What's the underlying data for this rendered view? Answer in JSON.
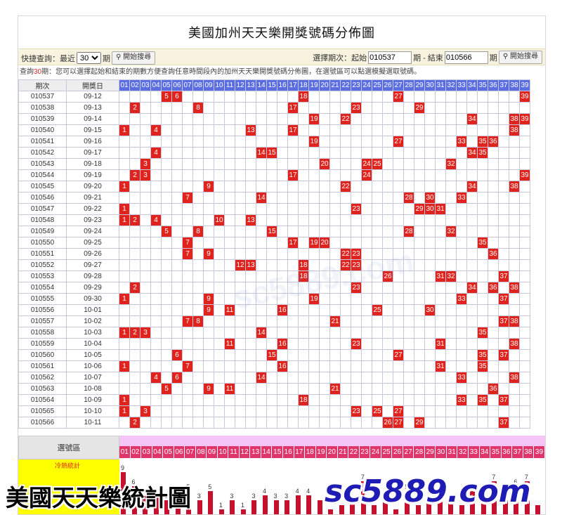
{
  "title": "美國加州天天樂開獎號碼分佈圖",
  "quick_query": {
    "label": "快捷查詢：最近",
    "value": "30",
    "options": [
      "30"
    ],
    "suffix": "期",
    "button": "開始搜尋"
  },
  "range_query": {
    "label": "選擇期次：起始",
    "start": "010537",
    "mid": "期 - 結束",
    "end": "010566",
    "suffix": "期",
    "button": "開始搜尋"
  },
  "note": {
    "prefix": "查詢",
    "count": "30",
    "text": "期：您可以選擇起始和結束的期數方便查詢任意時間段內的加州天天樂開獎號碼分佈圖，在選號區可以點選模擬選取號碼。"
  },
  "headers": {
    "period": "期次",
    "date": "開獎日"
  },
  "numbers": [
    "01",
    "02",
    "03",
    "04",
    "05",
    "06",
    "07",
    "08",
    "09",
    "10",
    "11",
    "12",
    "13",
    "14",
    "15",
    "16",
    "17",
    "18",
    "19",
    "20",
    "21",
    "22",
    "23",
    "24",
    "25",
    "26",
    "27",
    "28",
    "29",
    "30",
    "31",
    "32",
    "33",
    "34",
    "35",
    "36",
    "37",
    "38",
    "39"
  ],
  "draws": [
    {
      "period": "010537",
      "date": "09-12",
      "nums": [
        5,
        6,
        18,
        27,
        39
      ]
    },
    {
      "period": "010538",
      "date": "09-13",
      "nums": [
        2,
        8,
        17,
        23,
        29
      ]
    },
    {
      "period": "010539",
      "date": "09-14",
      "nums": [
        19,
        22,
        34,
        38,
        39
      ]
    },
    {
      "period": "010540",
      "date": "09-15",
      "nums": [
        1,
        4,
        13,
        17,
        38
      ]
    },
    {
      "period": "010541",
      "date": "09-16",
      "nums": [
        19,
        27,
        33,
        35,
        36
      ]
    },
    {
      "period": "010542",
      "date": "09-17",
      "nums": [
        4,
        14,
        15,
        34,
        35
      ]
    },
    {
      "period": "010543",
      "date": "09-18",
      "nums": [
        3,
        20,
        24,
        25,
        32
      ]
    },
    {
      "period": "010544",
      "date": "09-19",
      "nums": [
        2,
        3,
        17,
        24,
        39
      ]
    },
    {
      "period": "010545",
      "date": "09-20",
      "nums": [
        1,
        9,
        22,
        34,
        38
      ]
    },
    {
      "period": "010546",
      "date": "09-21",
      "nums": [
        7,
        14,
        28,
        30,
        33
      ]
    },
    {
      "period": "010547",
      "date": "09-22",
      "nums": [
        1,
        23,
        29,
        30,
        31
      ]
    },
    {
      "period": "010548",
      "date": "09-23",
      "nums": [
        1,
        2,
        4,
        10,
        13
      ]
    },
    {
      "period": "010549",
      "date": "09-24",
      "nums": [
        5,
        8,
        15,
        28,
        32
      ]
    },
    {
      "period": "010550",
      "date": "09-25",
      "nums": [
        7,
        17,
        19,
        20,
        35
      ]
    },
    {
      "period": "010551",
      "date": "09-26",
      "nums": [
        7,
        9,
        22,
        23,
        36
      ]
    },
    {
      "period": "010552",
      "date": "09-27",
      "nums": [
        12,
        13,
        18,
        22,
        23
      ]
    },
    {
      "period": "010553",
      "date": "09-28",
      "nums": [
        18,
        26,
        31,
        32,
        37
      ]
    },
    {
      "period": "010554",
      "date": "09-29",
      "nums": [
        2,
        23,
        34,
        36,
        38
      ]
    },
    {
      "period": "010555",
      "date": "09-30",
      "nums": [
        1,
        9,
        19,
        33,
        37
      ]
    },
    {
      "period": "010556",
      "date": "10-01",
      "nums": [
        9,
        11,
        16,
        25,
        30
      ]
    },
    {
      "period": "010557",
      "date": "10-02",
      "nums": [
        7,
        8,
        21,
        37,
        38
      ]
    },
    {
      "period": "010558",
      "date": "10-03",
      "nums": [
        1,
        2,
        3,
        14,
        35
      ]
    },
    {
      "period": "010559",
      "date": "10-04",
      "nums": [
        11,
        16,
        23,
        31,
        38
      ]
    },
    {
      "period": "010560",
      "date": "10-05",
      "nums": [
        6,
        15,
        27,
        35,
        37
      ]
    },
    {
      "period": "010561",
      "date": "10-06",
      "nums": [
        1,
        7,
        16,
        31,
        35
      ]
    },
    {
      "period": "010562",
      "date": "10-07",
      "nums": [
        4,
        6,
        14,
        33,
        38
      ]
    },
    {
      "period": "010563",
      "date": "10-08",
      "nums": [
        5,
        9,
        11,
        21,
        36
      ]
    },
    {
      "period": "010564",
      "date": "10-09",
      "nums": [
        1,
        18,
        33,
        35,
        37
      ]
    },
    {
      "period": "010565",
      "date": "10-10",
      "nums": [
        1,
        3,
        23,
        25,
        27
      ]
    },
    {
      "period": "010566",
      "date": "10-11",
      "nums": [
        2,
        26,
        27,
        29,
        37
      ]
    }
  ],
  "select_area_label": "選號區",
  "stats_label": "冷熱統計",
  "frequency": [
    9,
    6,
    4,
    4,
    3,
    3,
    5,
    3,
    5,
    1,
    3,
    1,
    3,
    4,
    3,
    3,
    4,
    4,
    3,
    1,
    2,
    3,
    7,
    2,
    3,
    1,
    5,
    2,
    3,
    3,
    3,
    2,
    5,
    4,
    7,
    4,
    6,
    7,
    2
  ],
  "frequency_visible_labels": [
    9,
    6,
    4,
    4,
    3,
    3,
    5,
    3,
    5,
    1,
    3,
    1,
    3,
    4,
    3,
    3,
    4,
    4,
    null,
    null,
    null,
    null,
    7,
    null,
    null,
    null,
    5,
    null,
    null,
    null,
    null,
    null,
    5,
    4,
    7,
    4,
    6,
    7,
    null
  ],
  "watermark_text": "sc5889.com",
  "caption_left": "美國天天樂統計圖",
  "caption_right": "sc5889.com",
  "colors": {
    "hit": "#e0231c",
    "header": "#5b6ee1",
    "numrow": "#e0356b",
    "bar": "#c8102e",
    "stats_bg": "#ffff00"
  }
}
